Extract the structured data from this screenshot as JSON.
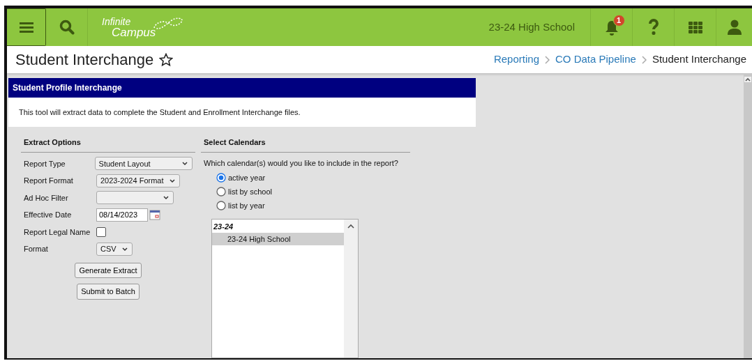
{
  "header": {
    "logo": {
      "line1": "Infinite",
      "line2": "Campus"
    },
    "school": "23-24 High School",
    "notification_count": "1"
  },
  "page": {
    "title": "Student Interchange",
    "favorite": false,
    "breadcrumbs": [
      {
        "label": "Reporting",
        "kind": "link"
      },
      {
        "label": "CO Data Pipeline",
        "kind": "link"
      },
      {
        "label": "Student Interchange",
        "kind": "current"
      }
    ]
  },
  "panel": {
    "title": "Student Profile Interchange",
    "description": "This tool will extract data to complete the Student and Enrollment Interchange files."
  },
  "extract_options": {
    "heading": "Extract Options",
    "fields": [
      {
        "label": "Report Type",
        "kind": "select",
        "value": "Student Layout"
      },
      {
        "label": "Report Format",
        "kind": "select",
        "value": "2023-2024 Format"
      },
      {
        "label": "Ad Hoc Filter",
        "kind": "select"
      },
      {
        "label": "Effective Date",
        "kind": "date",
        "value": "08/14/2023"
      },
      {
        "label": "Report Legal Name",
        "kind": "checkbox",
        "checked": false
      },
      {
        "label": "Format",
        "kind": "select",
        "value": "CSV"
      }
    ],
    "buttons": [
      "Generate Extract",
      "Submit to Batch"
    ]
  },
  "calendars": {
    "heading": "Select Calendars",
    "question": "Which calendar(s) would you like to include in the report?",
    "options": [
      {
        "label": "active year",
        "selected": true
      },
      {
        "label": "list by school",
        "selected": false
      },
      {
        "label": "list by year",
        "selected": false
      }
    ],
    "groups": [
      {
        "label": "23-24",
        "items": [
          {
            "label": "23-24 High School",
            "selected": true
          }
        ]
      }
    ]
  }
}
